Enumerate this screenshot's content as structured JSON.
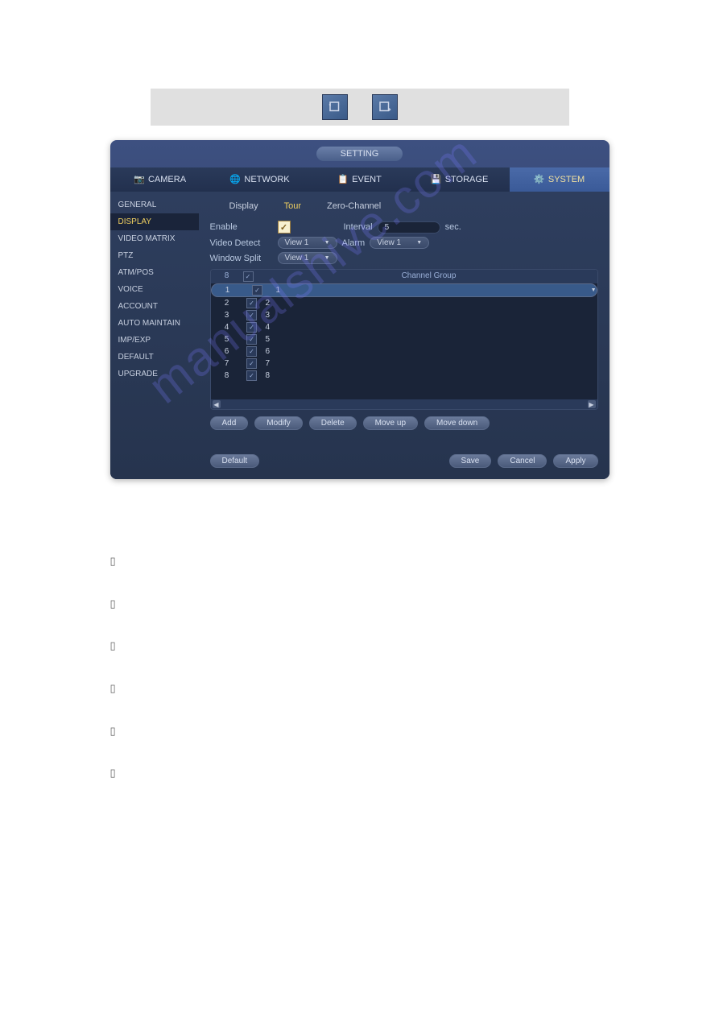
{
  "window_title": "SETTING",
  "top_tabs": [
    {
      "label": "CAMERA"
    },
    {
      "label": "NETWORK"
    },
    {
      "label": "EVENT"
    },
    {
      "label": "STORAGE"
    },
    {
      "label": "SYSTEM",
      "active": true
    }
  ],
  "sidebar": [
    {
      "label": "GENERAL"
    },
    {
      "label": "DISPLAY",
      "active": true
    },
    {
      "label": "VIDEO MATRIX"
    },
    {
      "label": "PTZ"
    },
    {
      "label": "ATM/POS"
    },
    {
      "label": "VOICE"
    },
    {
      "label": "ACCOUNT"
    },
    {
      "label": "AUTO MAINTAIN"
    },
    {
      "label": "IMP/EXP"
    },
    {
      "label": "DEFAULT"
    },
    {
      "label": "UPGRADE"
    }
  ],
  "sub_tabs": [
    {
      "label": "Display"
    },
    {
      "label": "Tour",
      "active": true
    },
    {
      "label": "Zero-Channel"
    }
  ],
  "form": {
    "enable_label": "Enable",
    "interval_label": "Interval",
    "interval_value": "5",
    "sec_label": "sec.",
    "video_detect_label": "Video Detect",
    "video_detect_value": "View 1",
    "alarm_label": "Alarm",
    "alarm_value": "View 1",
    "window_split_label": "Window Split",
    "window_split_value": "View 1"
  },
  "table": {
    "header_count": "8",
    "header_group": "Channel Group",
    "rows": [
      {
        "n": "1",
        "grp": "1",
        "selected": true
      },
      {
        "n": "2",
        "grp": "2"
      },
      {
        "n": "3",
        "grp": "3"
      },
      {
        "n": "4",
        "grp": "4"
      },
      {
        "n": "5",
        "grp": "5"
      },
      {
        "n": "6",
        "grp": "6"
      },
      {
        "n": "7",
        "grp": "7"
      },
      {
        "n": "8",
        "grp": "8"
      }
    ]
  },
  "buttons": {
    "add": "Add",
    "modify": "Modify",
    "delete": "Delete",
    "move_up": "Move up",
    "move_down": "Move down",
    "default": "Default",
    "save": "Save",
    "cancel": "Cancel",
    "apply": "Apply"
  },
  "body": {
    "bullets": [
      "",
      "",
      "",
      "",
      "",
      ""
    ]
  }
}
